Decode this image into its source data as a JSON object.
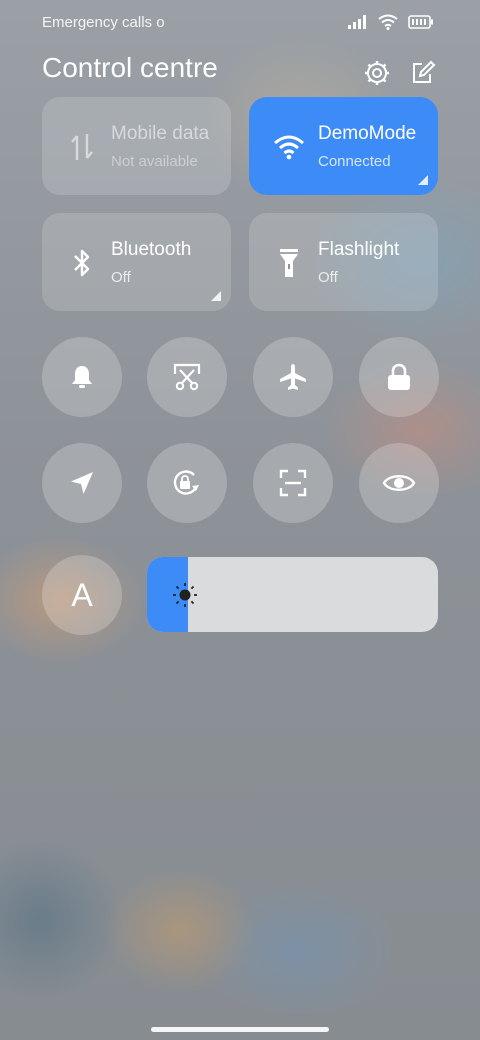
{
  "status_bar": {
    "left_text": "Emergency calls o",
    "icons": [
      "signal-icon",
      "wifi-icon",
      "battery-icon"
    ]
  },
  "header": {
    "title": "Control centre",
    "icons": [
      "settings-icon",
      "edit-icon"
    ]
  },
  "tiles": [
    {
      "label": "Mobile data",
      "sub": "Not available",
      "icon": "mobile-data-icon",
      "state": "unavailable"
    },
    {
      "label": "DemoMode",
      "sub": "Connected",
      "icon": "wifi-icon",
      "state": "active"
    },
    {
      "label": "Bluetooth",
      "sub": "Off",
      "icon": "bluetooth-icon",
      "state": "off"
    },
    {
      "label": "Flashlight",
      "sub": "Off",
      "icon": "flashlight-icon",
      "state": "off"
    }
  ],
  "toggles_row1": [
    "bell-icon",
    "screenshot-icon",
    "airplane-icon",
    "lock-icon"
  ],
  "toggles_row2": [
    "location-icon",
    "auto-rotate-icon",
    "scanner-icon",
    "eye-icon"
  ],
  "font_button": {
    "label": "A"
  },
  "brightness": {
    "level": 0.14,
    "icon": "sun-icon"
  },
  "colors": {
    "accent": "#3d8bf6"
  }
}
